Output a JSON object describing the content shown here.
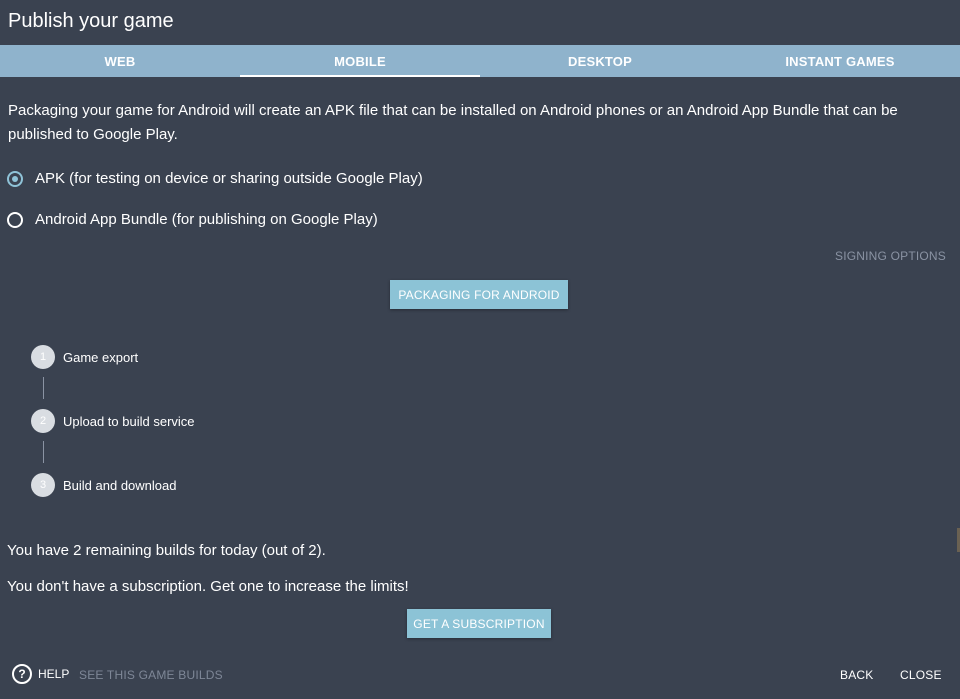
{
  "dialog": {
    "title": "Publish your game"
  },
  "tabs": [
    {
      "label": "WEB",
      "active": false
    },
    {
      "label": "MOBILE",
      "active": true
    },
    {
      "label": "DESKTOP",
      "active": false
    },
    {
      "label": "INSTANT GAMES",
      "active": false
    }
  ],
  "content": {
    "description": "Packaging your game for Android will create an APK file that can be installed on Android phones or an Android App Bundle that can be published to Google Play.",
    "options": [
      {
        "label": "APK (for testing on device or sharing outside Google Play)",
        "checked": true
      },
      {
        "label": "Android App Bundle (for publishing on Google Play)",
        "checked": false
      }
    ],
    "signing_options": "SIGNING OPTIONS",
    "package_button": "PACKAGING FOR ANDROID",
    "steps": [
      {
        "number": "1",
        "label": "Game export"
      },
      {
        "number": "2",
        "label": "Upload to build service"
      },
      {
        "number": "3",
        "label": "Build and download"
      }
    ],
    "remaining_builds": "You have 2 remaining builds for today (out of 2).",
    "subscription_notice": "You don't have a subscription. Get one to increase the limits!",
    "subscription_button": "GET A SUBSCRIPTION"
  },
  "footer": {
    "help_icon": "?",
    "help": "HELP",
    "see_builds": "SEE THIS GAME BUILDS",
    "back": "BACK",
    "close": "CLOSE"
  },
  "colors": {
    "background": "#3a4250",
    "tab_bar": "#8fb3cc",
    "accent": "#8cc3d6"
  }
}
